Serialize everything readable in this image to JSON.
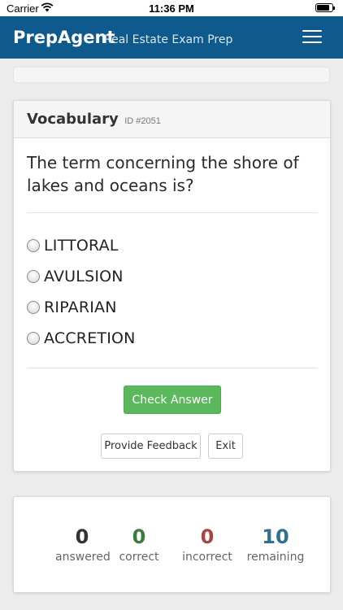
{
  "status_bar": {
    "carrier": "Carrier",
    "time": "11:36 PM",
    "battery_level": 0.85
  },
  "navbar": {
    "brand": "PrepAgent",
    "subtitle": "Real Estate Exam Prep",
    "menu_icon": "hamburger-menu-icon",
    "background_color": "#0f5a8c"
  },
  "progress": {
    "value": 0
  },
  "question_card": {
    "category": "Vocabulary",
    "id_label": "ID #2051",
    "question": "The term concerning the shore of lakes and oceans is?",
    "options": [
      {
        "label": "LITTORAL",
        "selected": false
      },
      {
        "label": "AVULSION",
        "selected": false
      },
      {
        "label": "RIPARIAN",
        "selected": false
      },
      {
        "label": "ACCRETION",
        "selected": false
      }
    ],
    "check_button": "Check Answer",
    "feedback_button": "Provide Feedback",
    "exit_button": "Exit"
  },
  "stats": {
    "answered": {
      "value": "0",
      "label": "answered",
      "color": "#333333"
    },
    "correct": {
      "value": "0",
      "label": "correct",
      "color": "#3c7a3c"
    },
    "incorrect": {
      "value": "0",
      "label": "incorrect",
      "color": "#a94442"
    },
    "remaining": {
      "value": "10",
      "label": "remaining",
      "color": "#31708f"
    }
  }
}
